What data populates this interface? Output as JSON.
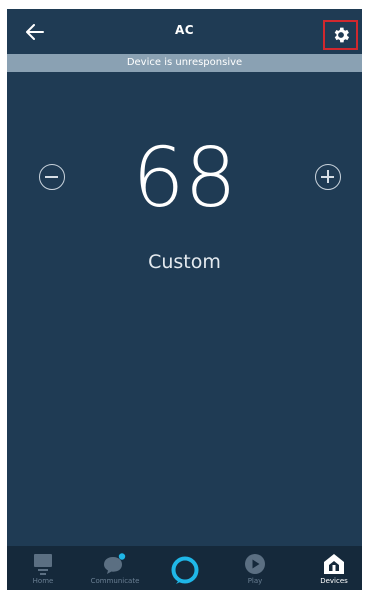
{
  "header": {
    "title": "AC",
    "back_icon": "arrow-left-icon",
    "settings_icon": "gear-icon",
    "highlight_color": "#d0282e"
  },
  "status": {
    "text": "Device is unresponsive"
  },
  "thermostat": {
    "temperature": "68",
    "mode": "Custom",
    "decrease_icon": "minus-circle-icon",
    "increase_icon": "plus-circle-icon"
  },
  "nav": {
    "items": [
      {
        "label": "Home",
        "icon": "home-icon"
      },
      {
        "label": "Communicate",
        "icon": "chat-bubble-icon"
      },
      {
        "label": "",
        "icon": "alexa-ring-icon"
      },
      {
        "label": "Play",
        "icon": "play-icon"
      },
      {
        "label": "Devices",
        "icon": "devices-house-icon"
      }
    ],
    "active": "Devices",
    "accent_color": "#1fb7e8"
  },
  "colors": {
    "background": "#1f3b54",
    "status_bar": "#8aa1b3",
    "nav_background": "#15293b"
  }
}
